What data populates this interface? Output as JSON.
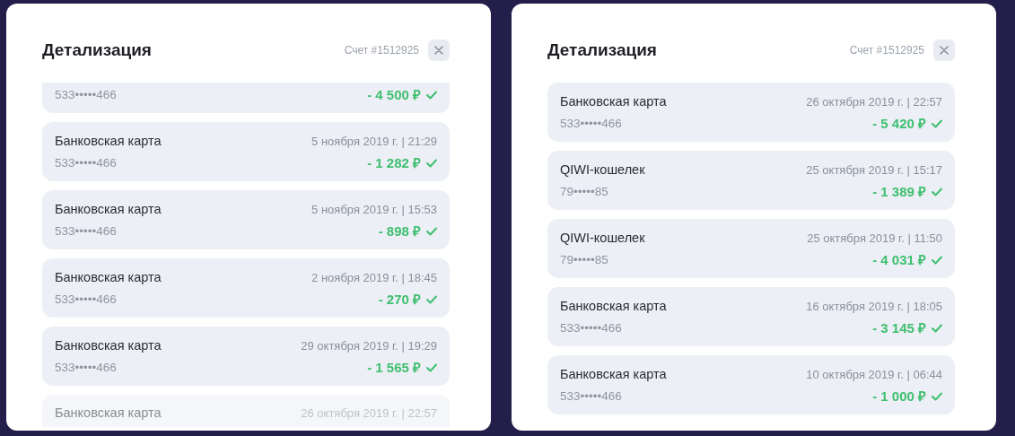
{
  "panels": [
    {
      "title": "Детализация",
      "account": "Счет #1512925",
      "fade_bottom": true,
      "rows": [
        {
          "cut_top": true,
          "number": "533•••••466",
          "amount": "- 4 500 ₽"
        },
        {
          "method": "Банковская карта",
          "date": "5 ноября 2019 г. | 21:29",
          "number": "533•••••466",
          "amount": "- 1 282 ₽"
        },
        {
          "method": "Банковская карта",
          "date": "5 ноября 2019 г. | 15:53",
          "number": "533•••••466",
          "amount": "- 898 ₽"
        },
        {
          "method": "Банковская карта",
          "date": "2 ноября 2019 г. | 18:45",
          "number": "533•••••466",
          "amount": "- 270 ₽"
        },
        {
          "method": "Банковская карта",
          "date": "29 октября 2019 г. | 19:29",
          "number": "533•••••466",
          "amount": "- 1 565 ₽"
        },
        {
          "cut_bottom": true,
          "method": "Банковская карта",
          "date": "26 октября 2019 г. | 22:57"
        }
      ]
    },
    {
      "title": "Детализация",
      "account": "Счет #1512925",
      "fade_bottom": false,
      "rows": [
        {
          "method": "Банковская карта",
          "date": "26 октября 2019 г. | 22:57",
          "number": "533•••••466",
          "amount": "- 5 420 ₽"
        },
        {
          "method": "QIWI-кошелек",
          "date": "25 октября 2019 г. | 15:17",
          "number": "79•••••85",
          "amount": "- 1 389 ₽"
        },
        {
          "method": "QIWI-кошелек",
          "date": "25 октября 2019 г. | 11:50",
          "number": "79•••••85",
          "amount": "- 4 031 ₽"
        },
        {
          "method": "Банковская карта",
          "date": "16 октября 2019 г. | 18:05",
          "number": "533•••••466",
          "amount": "- 3 145 ₽"
        },
        {
          "method": "Банковская карта",
          "date": "10 октября 2019 г. | 06:44",
          "number": "533•••••466",
          "amount": "- 1 000 ₽"
        }
      ]
    }
  ]
}
